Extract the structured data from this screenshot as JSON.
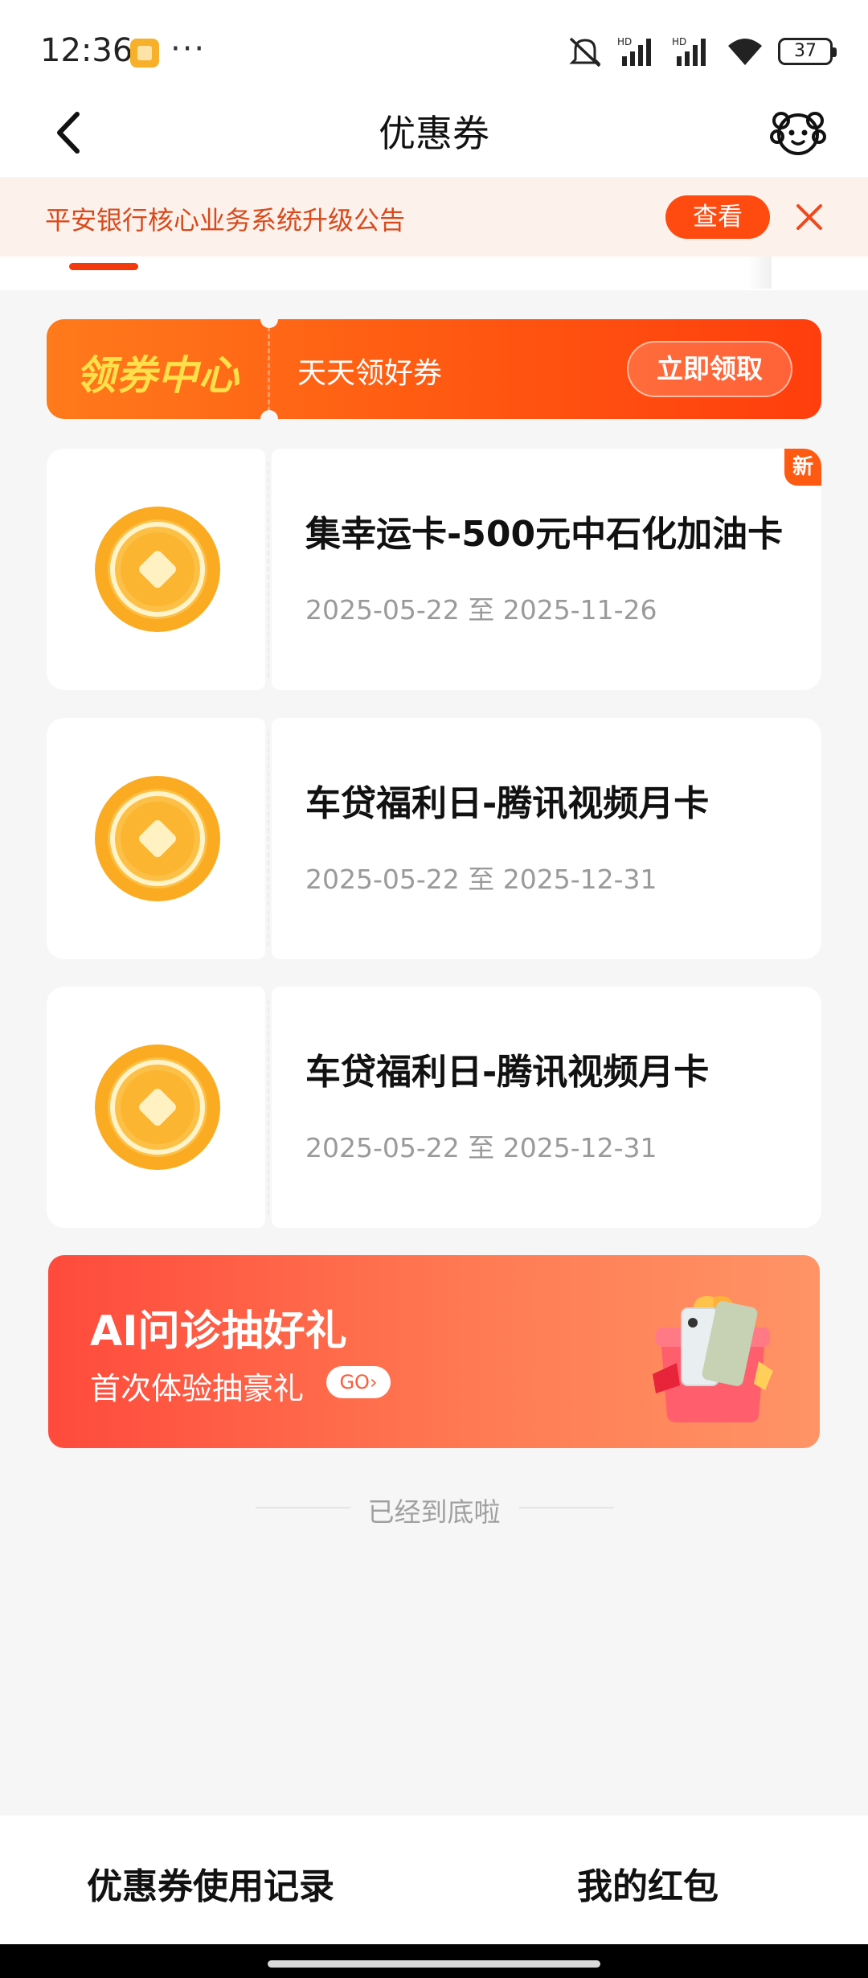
{
  "status_bar": {
    "time": "12:36",
    "dots": "···",
    "battery": "37",
    "icons": [
      "app-notification-icon",
      "mute-icon",
      "signal-hd-icon",
      "signal-hd-icon",
      "wifi-icon",
      "battery-icon"
    ]
  },
  "header": {
    "title": "优惠券",
    "back_icon": "back-arrow-icon",
    "mascot_icon": "mascot-icon"
  },
  "notice": {
    "text": "平安银行核心业务系统升级公告",
    "view_label": "查看",
    "close_icon": "close-icon"
  },
  "coupon_center": {
    "title": "领券中心",
    "subtitle": "天天领好券",
    "claim_label": "立即领取"
  },
  "coupons": [
    {
      "title": "集幸运卡-500元中石化加油卡",
      "date": "2025-05-22 至 2025-11-26",
      "badge": "新"
    },
    {
      "title": "车贷福利日-腾讯视频月卡",
      "date": "2025-05-22 至 2025-12-31"
    },
    {
      "title": "车贷福利日-腾讯视频月卡",
      "date": "2025-05-22 至 2025-12-31"
    }
  ],
  "ai_banner": {
    "title": "AI问诊抽好礼",
    "subtitle": "首次体验抽豪礼",
    "go_label": "GO"
  },
  "end_text": "已经到底啦",
  "bottom": {
    "records_label": "优惠券使用记录",
    "red_packet_label": "我的红包"
  },
  "colors": {
    "accent": "#ff4a10",
    "notice_bg": "#fdf1ec",
    "coupon_center_yellow": "#ffe04a",
    "coin": "#fbab21"
  }
}
